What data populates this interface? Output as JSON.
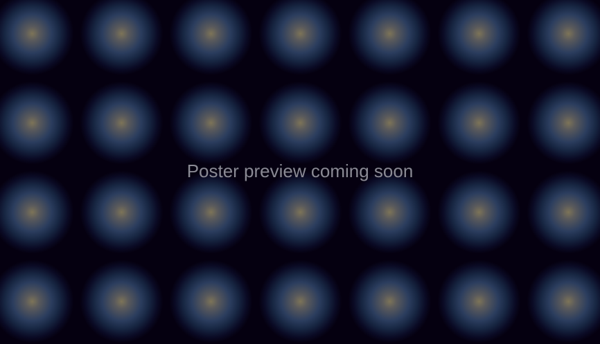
{
  "poster": {
    "placeholder_text": "Poster preview coming soon"
  },
  "colors": {
    "background": "#050010",
    "glow_center": "#7d7458",
    "glow_ring": "#2b3d5e",
    "text": "#8a8a94"
  }
}
